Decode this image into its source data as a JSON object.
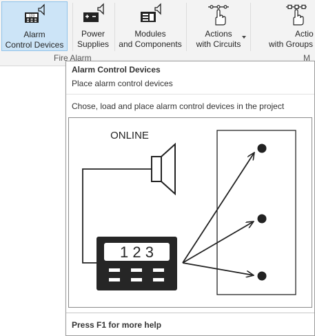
{
  "ribbon": {
    "buttons": [
      {
        "line1": "Alarm",
        "line2": "Control Devices",
        "icon": "alarm-control-device-icon"
      },
      {
        "line1": "Power",
        "line2": "Supplies",
        "icon": "power-supply-icon"
      },
      {
        "line1": "Modules",
        "line2": "and Components",
        "icon": "module-component-icon"
      },
      {
        "line1": "Actions",
        "line2": "with Circuits",
        "icon": "actions-circuits-icon"
      },
      {
        "line1": "Actio",
        "line2": "with Groups",
        "icon": "actions-groups-icon"
      }
    ],
    "group_label": "Fire Alarm",
    "group_label_partial": "M"
  },
  "tooltip": {
    "title": "Alarm Control Devices",
    "subtitle": "Place alarm control devices",
    "description": "Chose, load and place alarm control devices in the project",
    "illustration": {
      "online_label": "ONLINE",
      "display_digits": "1 2 3"
    },
    "help": "Press F1 for more help"
  },
  "colors": {
    "ribbon_bg": "#f3f3f3",
    "active_button_bg": "#cce4f7",
    "active_button_border": "#8fc2ea",
    "device_fill": "#262626"
  }
}
